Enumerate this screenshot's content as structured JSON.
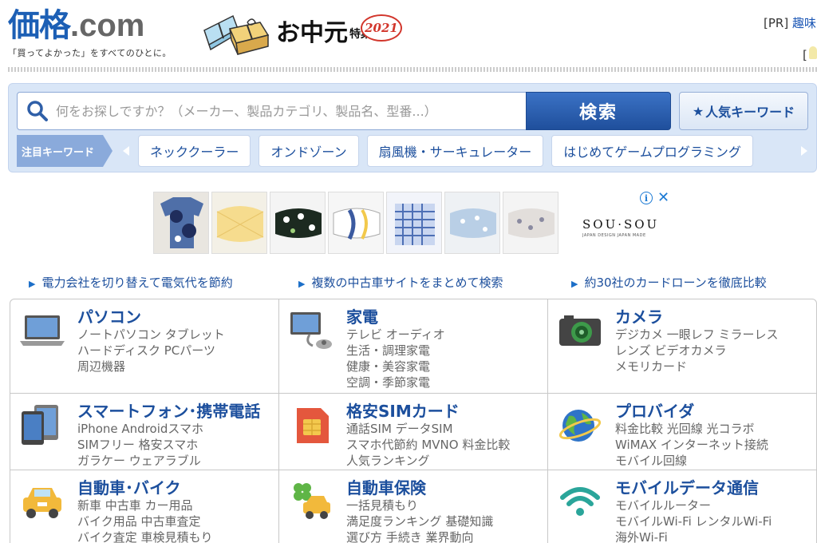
{
  "header": {
    "logo_jp": "価格",
    "logo_com": ".com",
    "tagline": "「買ってよかった」をすべてのひとに。",
    "promo_title": "お中元",
    "promo_sub": "特集",
    "promo_year": "2021",
    "pr_label": "[PR]",
    "pr_link": "趣味",
    "pr_bracket": "["
  },
  "search": {
    "placeholder": "何をお探しですか？（メーカー、製品カテゴリ、製品名、型番...）",
    "button_label": "検索",
    "popular_label": "人気キーワード",
    "keyword_label": "注目キーワード",
    "keywords": [
      "ネッククーラー",
      "オンドゾーン",
      "扇風機・サーキュレーター",
      "はじめてゲームプログラミング"
    ]
  },
  "ad": {
    "brand": "SOU·SOU",
    "brand_sub": "JAPAN DESIGN JAPAN MADE",
    "info_glyph": "i",
    "close_glyph": "✕"
  },
  "links": [
    "電力会社を切り替えて電気代を節約",
    "複数の中古車サイトをまとめて検索",
    "約30社のカードローンを徹底比較"
  ],
  "categories": [
    {
      "title": "パソコン",
      "icon": "laptop-icon",
      "subs": [
        "ノートパソコン タブレット",
        "ハードディスク PCパーツ",
        "周辺機器"
      ]
    },
    {
      "title": "家電",
      "icon": "appliance-icon",
      "subs": [
        "テレビ オーディオ",
        "生活・調理家電",
        "健康・美容家電",
        "空調・季節家電"
      ]
    },
    {
      "title": "カメラ",
      "icon": "camera-icon",
      "subs": [
        "デジカメ 一眼レフ ミラーレス",
        "レンズ ビデオカメラ",
        "メモリカード"
      ]
    },
    {
      "title": "スマートフォン･携帯電話",
      "icon": "smartphone-icon",
      "subs": [
        "iPhone Androidスマホ",
        "SIMフリー 格安スマホ",
        "ガラケー ウェアラブル"
      ]
    },
    {
      "title": "格安SIMカード",
      "icon": "sim-card-icon",
      "subs": [
        "通話SIM データSIM",
        "スマホ代節約 MVNO 料金比較",
        "人気ランキング"
      ]
    },
    {
      "title": "プロバイダ",
      "icon": "globe-icon",
      "subs": [
        "料金比較 光回線 光コラボ",
        "WiMAX インターネット接続",
        "モバイル回線"
      ]
    },
    {
      "title": "自動車･バイク",
      "icon": "car-icon",
      "subs": [
        "新車 中古車 カー用品",
        "バイク用品 中古車査定",
        "バイク査定 車検見積もり"
      ]
    },
    {
      "title": "自動車保険",
      "icon": "car-insurance-icon",
      "subs": [
        "一括見積もり",
        "満足度ランキング 基礎知識",
        "選び方 手続き 業界動向"
      ]
    },
    {
      "title": "モバイルデータ通信",
      "icon": "wifi-icon",
      "subs": [
        "モバイルルーター",
        "モバイルWi-Fi レンタルWi-Fi",
        "海外Wi-Fi"
      ]
    }
  ],
  "colors": {
    "brand_blue": "#1c5fb5",
    "link_blue": "#1c4f9d",
    "panel_bg": "#d9e6f7",
    "search_button": "#2a5fb0"
  }
}
